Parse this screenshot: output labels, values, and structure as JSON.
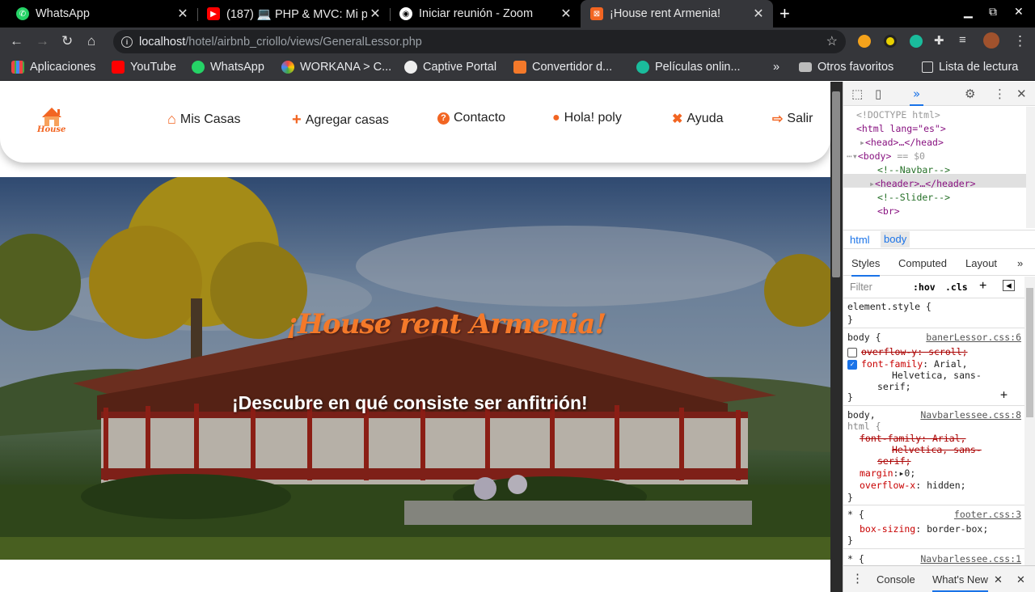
{
  "browser": {
    "tabs": [
      {
        "title": "WhatsApp",
        "icon": "whatsapp-icon"
      },
      {
        "title": "(187) 💻 PHP & MVC: Mi p",
        "icon": "youtube-icon"
      },
      {
        "title": "Iniciar reunión - Zoom",
        "icon": "zoom-icon"
      },
      {
        "title": "¡House rent Armenia!",
        "icon": "xampp-icon",
        "active": true
      }
    ],
    "url_host": "localhost",
    "url_path": "/hotel/airbnb_criollo/views/GeneralLessor.php",
    "bookmarks": [
      {
        "label": "Aplicaciones",
        "icon": "apps-grid-icon"
      },
      {
        "label": "YouTube",
        "icon": "youtube-icon"
      },
      {
        "label": "WhatsApp",
        "icon": "whatsapp-icon"
      },
      {
        "label": "WORKANA > C...",
        "icon": "workana-icon"
      },
      {
        "label": "Captive Portal",
        "icon": "globe-icon"
      },
      {
        "label": "Convertidor d...",
        "icon": "converter-icon"
      },
      {
        "label": "Películas onlin...",
        "icon": "c-logo-icon"
      }
    ],
    "bookmarks_right": [
      {
        "label": "Otros favoritos",
        "icon": "folder-icon"
      },
      {
        "label": "Lista de lectura",
        "icon": "reading-list-icon"
      }
    ],
    "more_bookmarks": "»"
  },
  "site": {
    "logo_text": "House",
    "menu": [
      {
        "label": "Mis Casas",
        "icon": "home-icon",
        "glyph": "⌂"
      },
      {
        "label": "Agregar casas",
        "icon": "plus-icon",
        "glyph": "+"
      },
      {
        "label": "Contacto",
        "icon": "question-circle-icon",
        "glyph": "?"
      },
      {
        "label": "Hola! poly",
        "icon": "user-icon",
        "glyph": "●"
      },
      {
        "label": "Ayuda",
        "icon": "tools-icon",
        "glyph": "✖"
      },
      {
        "label": "Salir",
        "icon": "sign-out-icon",
        "glyph": "⇨"
      }
    ],
    "hero_title": "¡House rent Armenia!",
    "hero_subtitle": "¡Descubre en qué consiste ser anfitrión!"
  },
  "devtools": {
    "dom": {
      "doctype": "<!DOCTYPE html>",
      "html_open": "<html lang=\"es\">",
      "head": "<head>…</head>",
      "body": "<body>",
      "body_suffix": "== $0",
      "c_navbar": "<!--Navbar-->",
      "header": "<header>…</header>",
      "c_slider": "<!--Slider-->",
      "br": "<br>"
    },
    "crumbs": [
      "html",
      "body"
    ],
    "panel_tabs": [
      "Styles",
      "Computed",
      "Layout",
      "»"
    ],
    "filter_placeholder": "Filter",
    "hov": ":hov",
    "cls": ".cls",
    "styles": {
      "element_style": "element.style {",
      "close": "}",
      "r1_selector": "body {",
      "r1_source": "banerLessor.css:6",
      "r1_p1": "overflow-y: scroll;",
      "r1_p2_name": "font-family",
      "r1_p2_val": ": Arial,",
      "r1_p2_val2": "Helvetica, sans-",
      "r1_p2_val3": "serif;",
      "r2_selector": "body,",
      "r2_selector2": "html {",
      "r2_source": "Navbarlessee.css:8",
      "r2_p1a": "font-family: Arial,",
      "r2_p1b": "Helvetica, sans-",
      "r2_p1c": "serif;",
      "r2_p2_name": "margin",
      "r2_p2_val": ":▸0;",
      "r2_p3_name": "overflow-x",
      "r2_p3_val": ": hidden;",
      "r3_selector": "* {",
      "r3_source": "footer.css:3",
      "r3_p1_name": "box-sizing",
      "r3_p1_val": ": border-box;",
      "r4_selector": "* {",
      "r4_source": "Navbarlessee.css:1"
    },
    "drawer_tabs": [
      "Console",
      "What's New"
    ]
  }
}
